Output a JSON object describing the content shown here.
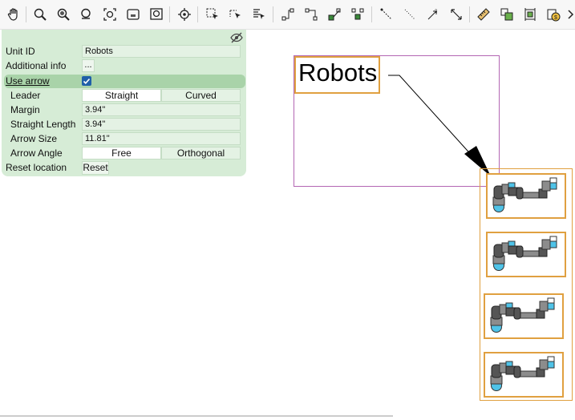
{
  "toolbar": {
    "tools": [
      "hand-icon",
      "zoom-icon",
      "zoom-in-icon",
      "zoom-out-icon",
      "zoom-fit-icon",
      "zoom-page-icon",
      "zoom-window-icon",
      "center-icon",
      "select-icon",
      "select-area-icon",
      "select-text-icon",
      "connector-1-icon",
      "connector-2-icon",
      "connector-3-icon",
      "connector-4-icon",
      "line-1-icon",
      "line-2-icon",
      "line-3-icon",
      "line-4-icon",
      "ruler-icon",
      "component-1-icon",
      "component-2-icon",
      "component-3-icon",
      "more-icon"
    ]
  },
  "panel": {
    "rows": {
      "unit_id": {
        "label": "Unit ID",
        "value": "Robots"
      },
      "additional_info": {
        "label": "Additional info",
        "button": "..."
      },
      "use_arrow": {
        "label": "Use arrow",
        "checked": true
      },
      "leader": {
        "label": "Leader",
        "options": [
          "Straight",
          "Curved"
        ],
        "selected": "Straight"
      },
      "margin": {
        "label": "Margin",
        "value": "3.94\""
      },
      "straight_length": {
        "label": "Straight Length",
        "value": "3.94\""
      },
      "arrow_size": {
        "label": "Arrow Size",
        "value": "11.81\""
      },
      "arrow_angle": {
        "label": "Arrow Angle",
        "options": [
          "Free",
          "Orthogonal"
        ],
        "selected": "Free"
      },
      "reset_location": {
        "label": "Reset location",
        "button": "Reset"
      }
    }
  },
  "canvas": {
    "label_text": "Robots",
    "robot_count": 4
  },
  "colors": {
    "panel_bg": "#d6ecd6",
    "highlight_row": "#a9d3a9",
    "orange_frame": "#e0a040",
    "purple_frame": "#b366b3",
    "checkbox": "#1f5fa8",
    "robot_blue": "#4fc3e8",
    "robot_gray": "#8c8c8c"
  }
}
